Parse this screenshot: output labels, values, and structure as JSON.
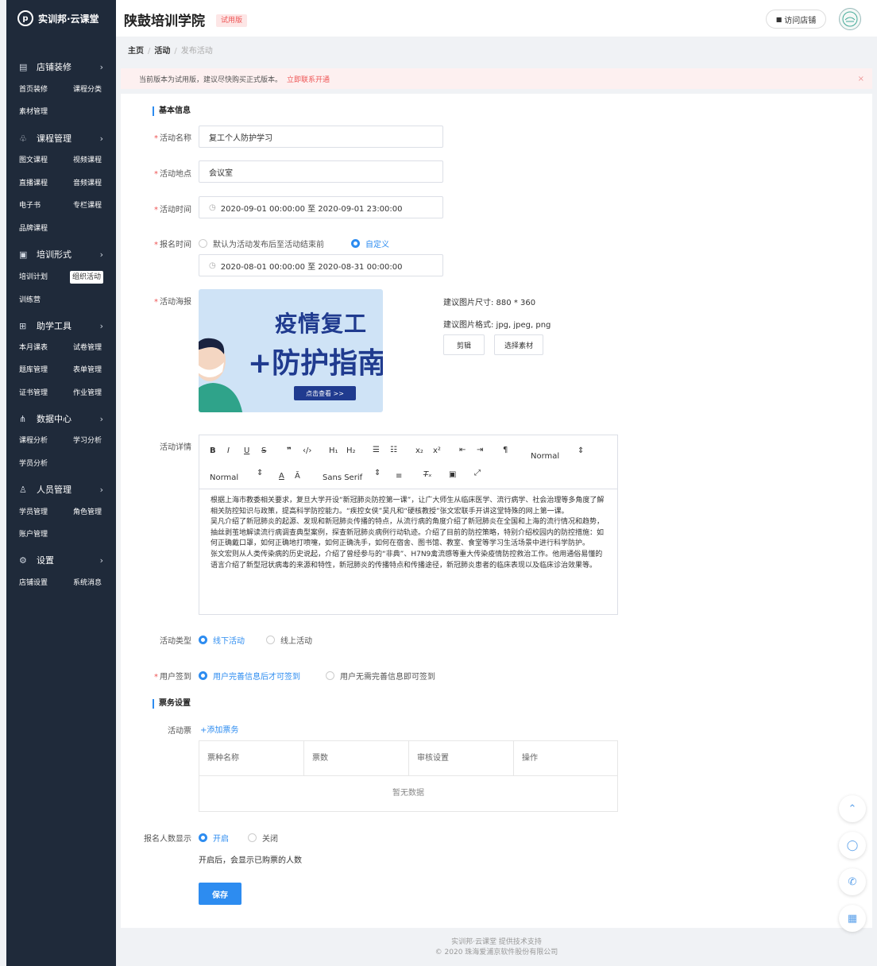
{
  "sidebar": {
    "brand": "实训邦·云课堂",
    "groups": [
      {
        "label": "店铺装修",
        "icon": "store-icon",
        "items": [
          "首页装修",
          "课程分类",
          "素材管理"
        ]
      },
      {
        "label": "课程管理",
        "icon": "book-icon",
        "items": [
          "图文课程",
          "视频课程",
          "直播课程",
          "音频课程",
          "电子书",
          "专栏课程",
          "品牌课程"
        ]
      },
      {
        "label": "培训形式",
        "icon": "training-icon",
        "items": [
          "培训计划",
          "组织活动",
          "训练营"
        ]
      },
      {
        "label": "助学工具",
        "icon": "tools-icon",
        "items": [
          "本月课表",
          "试卷管理",
          "题库管理",
          "表单管理",
          "证书管理",
          "作业管理"
        ]
      },
      {
        "label": "数据中心",
        "icon": "chart-icon",
        "items": [
          "课程分析",
          "学习分析",
          "学员分析"
        ]
      },
      {
        "label": "人员管理",
        "icon": "users-icon",
        "items": [
          "学员管理",
          "角色管理",
          "账户管理"
        ]
      },
      {
        "label": "设置",
        "icon": "gear-icon",
        "items": [
          "店铺设置",
          "系统消息"
        ]
      }
    ],
    "active_item": "组织活动"
  },
  "header": {
    "school": "陕鼓培训学院",
    "badge": "试用版",
    "visit": "访问店铺"
  },
  "breadcrumb": {
    "home": "主页",
    "parent": "活动",
    "current": "发布活动"
  },
  "notice": {
    "text": "当前版本为试用版，建议尽快购买正式版本。",
    "link": "立即联系开通",
    "close": "×"
  },
  "form": {
    "basic_title": "基本信息",
    "name_label": "活动名称",
    "name_value": "复工个人防护学习",
    "place_label": "活动地点",
    "place_value": "会议室",
    "time_label": "活动时间",
    "time_value": "2020-09-01 00:00:00 至 2020-09-01 23:00:00",
    "signup_label": "报名时间",
    "signup_opt1": "默认为活动发布后至活动结束前",
    "signup_opt2": "自定义",
    "signup_value": "2020-08-01 00:00:00 至 2020-08-31 00:00:00",
    "poster_label": "活动海报",
    "poster_title1": "疫情复工",
    "poster_title2": "+防护指南",
    "poster_button": "点击查看 >>",
    "poster_size_hint": "建议图片尺寸:  880 * 360",
    "poster_format_hint": "建议图片格式:  jpg, jpeg, png",
    "crop_btn": "剪辑",
    "choose_btn": "选择素材",
    "detail_label": "活动详情",
    "toolbar": {
      "normal1": "Normal",
      "normal2": "Normal",
      "font": "Sans Serif"
    },
    "detail_paragraphs": [
      "根据上海市教委相关要求，复旦大学开设“新冠肺炎防控第一课”，让广大师生从临床医学、流行病学、社会治理等多角度了解相关防控知识与政策，提高科学防控能力。“疾控女侠”吴凡和“硬核教授”张文宏联手开讲这堂特殊的网上第一课。",
      "吴凡介绍了新冠肺炎的起源、发现和新冠肺炎传播的特点，从流行病的角度介绍了新冠肺炎在全国和上海的流行情况和趋势，抽丝剥茧地解读流行病调查典型案例，探查新冠肺炎病例行动轨迹。介绍了目前的防控策略，特别介绍校园内的防控措施：如何正确戴口罩，如何正确地打喷嚏，如何正确洗手，如何在宿舍、图书馆、教室、食堂等学习生活场景中进行科学防护。",
      "张文宏则从人类传染病的历史说起，介绍了曾经参与的“非典”、H7N9禽流感等重大传染疫情防控救治工作。他用通俗易懂的语言介绍了新型冠状病毒的来源和特性，新冠肺炎的传播特点和传播途径，新冠肺炎患者的临床表现以及临床诊治效果等。"
    ],
    "type_label": "活动类型",
    "type_opt1": "线下活动",
    "type_opt2": "线上活动",
    "checkin_label": "用户签到",
    "checkin_opt1": "用户完善信息后才可签到",
    "checkin_opt2": "用户无需完善信息即可签到",
    "ticket_title": "票务设置",
    "ticket_label": "活动票",
    "add_ticket": "+添加票务",
    "table_headers": [
      "票种名称",
      "票数",
      "审核设置",
      "操作"
    ],
    "table_empty": "暂无数据",
    "count_label": "报名人数显示",
    "count_opt1": "开启",
    "count_opt2": "关闭",
    "count_note": "开启后，会显示已购票的人数",
    "save": "保存"
  },
  "footer": {
    "line1": "实训邦·云课堂 提供技术支持",
    "line2": "© 2020 珠海爱浦京软件股份有限公司"
  },
  "colors": {
    "sidebar": "#1f2a3a",
    "accent": "#2d8cf0",
    "danger": "#e55555"
  }
}
